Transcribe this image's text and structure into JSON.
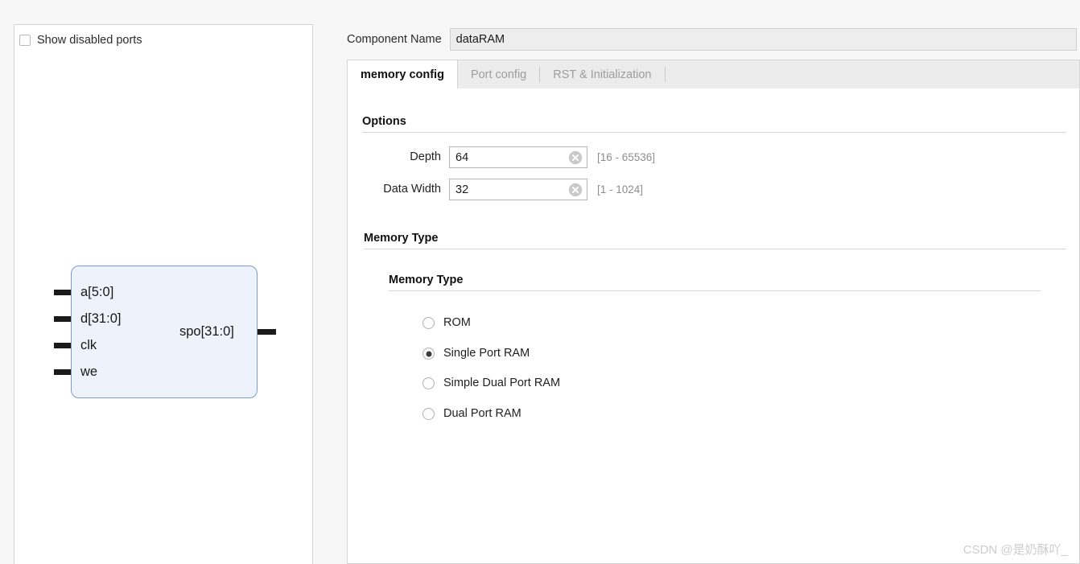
{
  "left_panel": {
    "show_disabled_ports_label": "Show disabled ports",
    "diagram": {
      "inputs": [
        {
          "label": "a[5:0]"
        },
        {
          "label": "d[31:0]"
        },
        {
          "label": "clk"
        },
        {
          "label": "we"
        }
      ],
      "outputs": [
        {
          "label": "spo[31:0]"
        }
      ]
    }
  },
  "header": {
    "component_name_label": "Component Name",
    "component_name_value": "dataRAM"
  },
  "tabs": [
    {
      "label": "memory config",
      "active": true
    },
    {
      "label": "Port config",
      "active": false
    },
    {
      "label": "RST & Initialization",
      "active": false
    }
  ],
  "options": {
    "section_title": "Options",
    "fields": [
      {
        "label": "Depth",
        "value": "64",
        "range": "[16 - 65536]"
      },
      {
        "label": "Data Width",
        "value": "32",
        "range": "[1 - 1024]"
      }
    ]
  },
  "memory_type": {
    "section_title": "Memory Type",
    "group_title": "Memory Type",
    "options": [
      {
        "label": "ROM",
        "selected": false
      },
      {
        "label": "Single Port RAM",
        "selected": true
      },
      {
        "label": "Simple Dual Port RAM",
        "selected": false
      },
      {
        "label": "Dual Port RAM",
        "selected": false
      }
    ]
  },
  "watermark": "CSDN @是奶酥吖_",
  "colors": {
    "block_fill": "#eef3fb",
    "block_border": "#7a9ccc",
    "accent_text": "#111111"
  }
}
